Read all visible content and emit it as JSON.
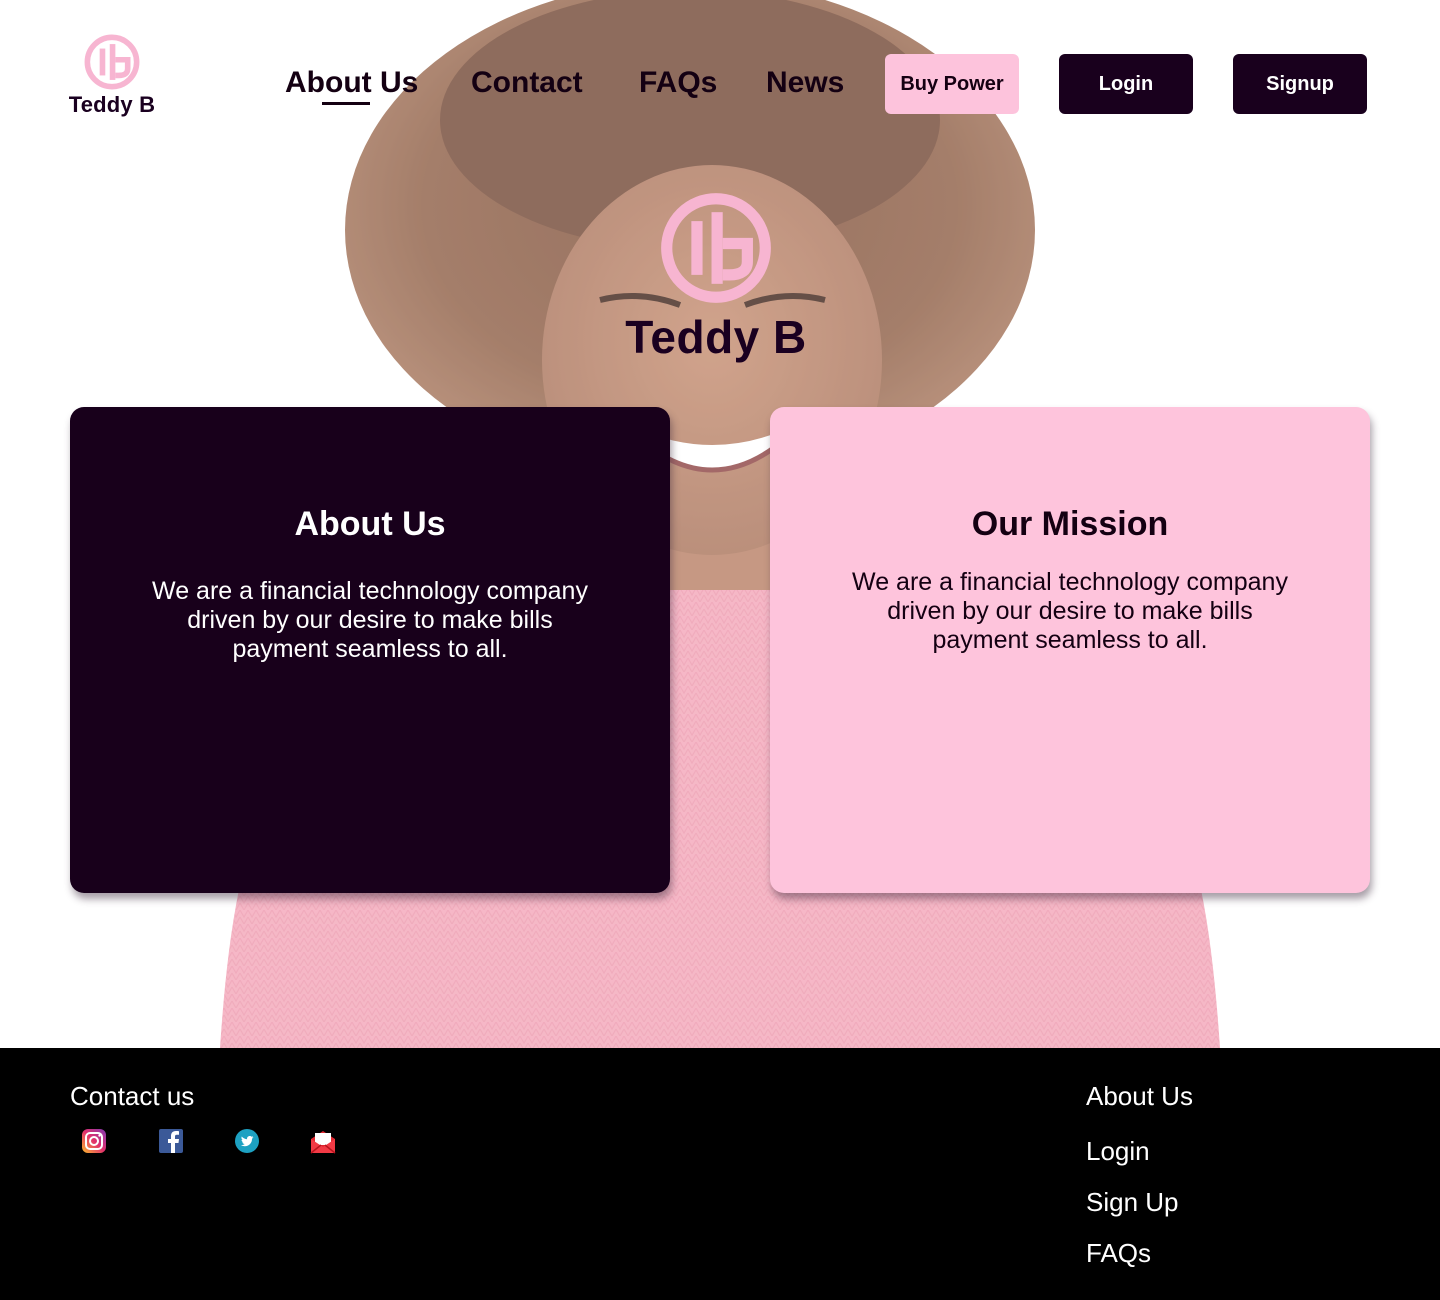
{
  "brand": {
    "name": "Teddy B",
    "colors": {
      "pink": "#fdc3dc",
      "dark": "#19001d",
      "footer": "#000000"
    }
  },
  "header": {
    "logo_text": "Teddy B",
    "nav": [
      {
        "label": "About Us",
        "active": true
      },
      {
        "label": "Contact"
      },
      {
        "label": "FAQs"
      },
      {
        "label": "News"
      }
    ],
    "buttons": {
      "buy_power": "Buy Power",
      "login": "Login",
      "signup": "Signup"
    }
  },
  "hero": {
    "logo_text": "Teddy B",
    "background": "smiling-woman-photo"
  },
  "cards": {
    "about": {
      "title": "About Us",
      "text": "We are a financial technology company driven by our desire to make bills payment seamless to all."
    },
    "mission": {
      "title": "Our Mission",
      "text": "We are a financial technology company driven by our desire to make bills payment seamless to all."
    }
  },
  "footer": {
    "contact_heading": "Contact us",
    "social_icons": [
      "instagram-icon",
      "facebook-icon",
      "twitter-icon",
      "mail-icon"
    ],
    "links": [
      "About Us",
      "Login",
      "Sign Up",
      "FAQs"
    ]
  }
}
